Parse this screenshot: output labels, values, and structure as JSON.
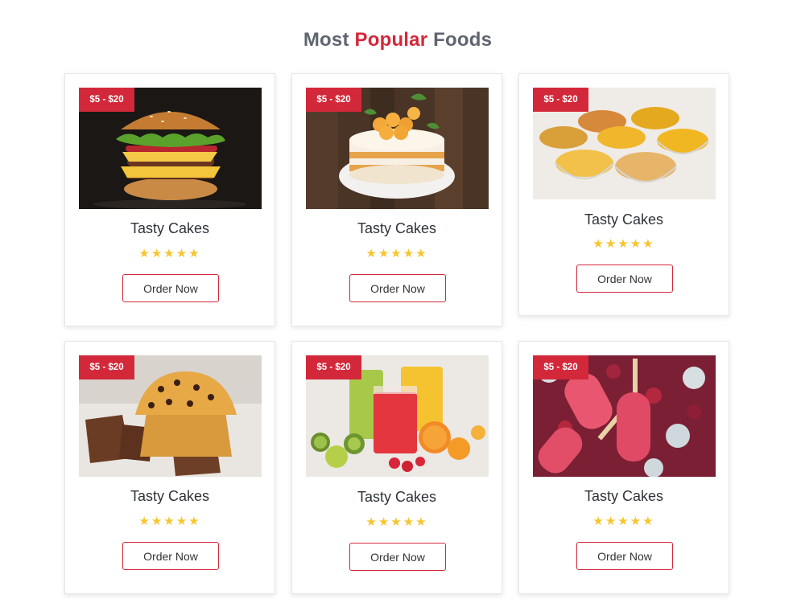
{
  "section": {
    "title_part1": "Most",
    "title_accent": "Popular",
    "title_part2": "Foods",
    "accent_color": "#d3283a"
  },
  "cards": [
    {
      "badge": "$5 - $20",
      "title": "Tasty Cakes",
      "stars": "★★★★★",
      "rating": 5,
      "button": "Order Now",
      "image": "burger-photo"
    },
    {
      "badge": "$5 - $20",
      "title": "Tasty Cakes",
      "stars": "★★★★★",
      "rating": 5,
      "button": "Order Now",
      "image": "cake-photo"
    },
    {
      "badge": "$5 - $20",
      "title": "Tasty Cakes",
      "stars": "★★★★★",
      "rating": 5,
      "button": "Order Now",
      "image": "snacks-photo"
    },
    {
      "badge": "$5 - $20",
      "title": "Tasty Cakes",
      "stars": "★★★★★",
      "rating": 5,
      "button": "Order Now",
      "image": "muffin-photo"
    },
    {
      "badge": "$5 - $20",
      "title": "Tasty Cakes",
      "stars": "★★★★★",
      "rating": 5,
      "button": "Order Now",
      "image": "juice-photo"
    },
    {
      "badge": "$5 - $20",
      "title": "Tasty Cakes",
      "stars": "★★★★★",
      "rating": 5,
      "button": "Order Now",
      "image": "popsicle-photo"
    }
  ]
}
